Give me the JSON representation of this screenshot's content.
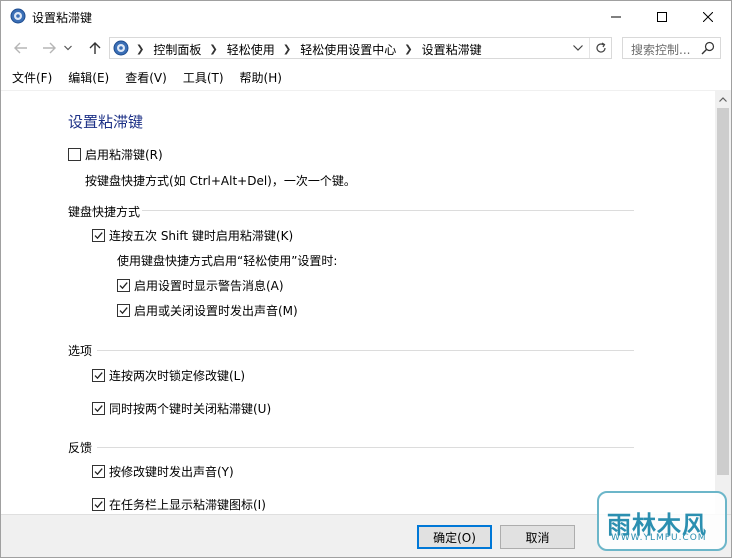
{
  "window": {
    "title": "设置粘滞键",
    "title_icon": "control-panel-icon"
  },
  "nav": {
    "crumbs": [
      "控制面板",
      "轻松使用",
      "轻松使用设置中心",
      "设置粘滞键"
    ],
    "search_placeholder": "搜索控制...",
    "address_icon": "control-panel-icon"
  },
  "menu": {
    "items": [
      "文件(F)",
      "编辑(E)",
      "查看(V)",
      "工具(T)",
      "帮助(H)"
    ]
  },
  "content": {
    "page_title": "设置粘滞键",
    "enable_sticky": {
      "label": "启用粘滞键(R)",
      "checked": false
    },
    "enable_desc": "按键盘快捷方式(如 Ctrl+Alt+Del)，一次一个键。",
    "shortcut_section": {
      "heading": "键盘快捷方式",
      "shift_five": {
        "label": "连按五次 Shift 键时启用粘滞键(K)",
        "checked": true
      },
      "when_label": "使用键盘快捷方式启用“轻松使用”设置时:",
      "show_warning": {
        "label": "启用设置时显示警告消息(A)",
        "checked": true
      },
      "play_sound": {
        "label": "启用或关闭设置时发出声音(M)",
        "checked": true
      }
    },
    "options_section": {
      "heading": "选项",
      "lock_modifier": {
        "label": "连按两次时锁定修改键(L)",
        "checked": true
      },
      "turn_off_two_keys": {
        "label": "同时按两个键时关闭粘滞键(U)",
        "checked": true
      }
    },
    "feedback_section": {
      "heading": "反馈",
      "beep_modifier": {
        "label": "按修改键时发出声音(Y)",
        "checked": true
      },
      "taskbar_icon": {
        "label": "在任务栏上显示粘滞键图标(I)",
        "checked": true
      }
    }
  },
  "buttons": {
    "ok": "确定(O)",
    "cancel": "取消"
  },
  "watermark": {
    "main": "雨林木风",
    "sub": "WWW.YLMFU.COM"
  },
  "colors": {
    "title_blue": "#1e3287",
    "focus_blue": "#0078d7",
    "watermark": "#2b8fb0"
  }
}
